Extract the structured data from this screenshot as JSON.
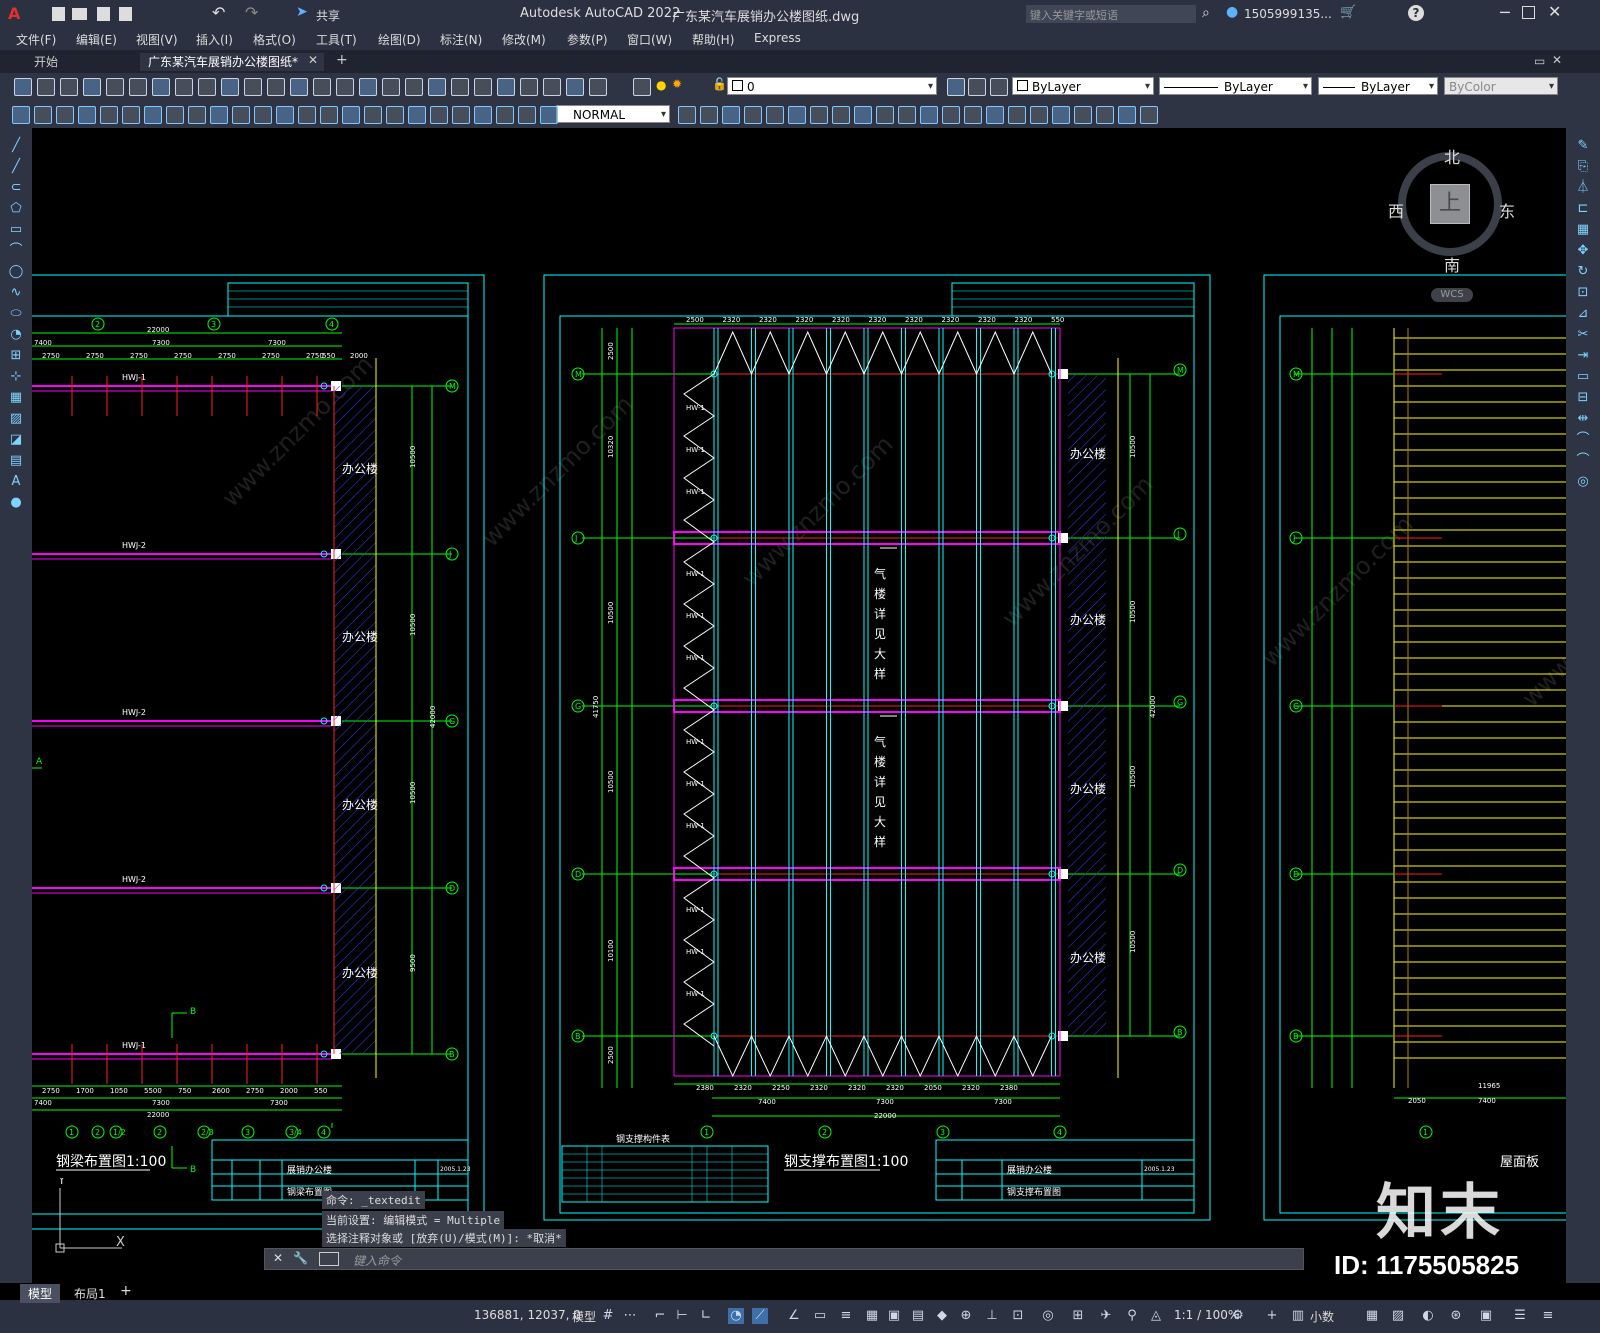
{
  "titlebar": {
    "app_title": "Autodesk AutoCAD 2022",
    "file_name": "广东某汽车展销办公楼图纸.dwg",
    "share_label": "共享",
    "search_placeholder": "键入关键字或短语",
    "user": "1505999135...",
    "app_letter": "A"
  },
  "menu": [
    "文件(F)",
    "编辑(E)",
    "视图(V)",
    "插入(I)",
    "格式(O)",
    "工具(T)",
    "绘图(D)",
    "标注(N)",
    "修改(M)",
    "参数(P)",
    "窗口(W)",
    "帮助(H)",
    "Express"
  ],
  "tabs": {
    "start": "开始",
    "drawing": "广东某汽车展销办公楼图纸*",
    "add": "+"
  },
  "toolbar": {
    "layer_value": "0",
    "color": "ByLayer",
    "linetype": "ByLayer",
    "lineweight": "ByLayer",
    "plotstyle": "ByColor",
    "textstyle": "NORMAL"
  },
  "viewcube": {
    "north": "北",
    "south": "南",
    "east": "东",
    "west": "西",
    "top": "上",
    "wcs": "WCS"
  },
  "drawing": {
    "sheet1": {
      "title": "钢梁布置图1:100",
      "beams": [
        "HWJ-1",
        "HWJ-2",
        "HWJ-2",
        "HWJ-2",
        "HWJ-1"
      ],
      "room_label": "办公楼",
      "axes": [
        "M",
        "J",
        "G",
        "D",
        "B"
      ],
      "top_axes": [
        "2",
        "3",
        "4"
      ],
      "project": "展销办公楼",
      "sheet_name": "钢梁布置图",
      "date": "2005.1.23",
      "marker_a": "A",
      "marker_b": "B",
      "top_dims": [
        "22000",
        "7400",
        "7300",
        "7300",
        "2750",
        "2750",
        "2750",
        "2750",
        "2750",
        "2750",
        "2750",
        "2000",
        "550"
      ],
      "right_dims": [
        "10500",
        "10500",
        "10500",
        "9500",
        "42000"
      ],
      "bot_dims": [
        "2750",
        "1700",
        "1050",
        "5500",
        "750",
        "2600",
        "2750",
        "2000",
        "550",
        "7400",
        "7300",
        "7300",
        "22000"
      ],
      "bot_axes": [
        "1",
        "2",
        "1/2",
        "2",
        "2/3",
        "3",
        "3/4",
        "4"
      ]
    },
    "sheet2": {
      "title": "钢支撑布置图1:100",
      "table_title": "钢支撑构件表",
      "room_label": "办公楼",
      "stair_note": "气楼详见大样",
      "axes": [
        "M",
        "J",
        "G",
        "D",
        "B"
      ],
      "bottom_axes": [
        "1",
        "2",
        "3",
        "4"
      ],
      "sheet_name": "钢支撑布置图",
      "project": "展销办公楼",
      "date": "2005.1.23",
      "hw_label": "HW-1",
      "top_dims": [
        "2500",
        "2320",
        "2320",
        "2320",
        "2320",
        "2320",
        "2320",
        "2320",
        "2320",
        "2320",
        "550"
      ],
      "bot_dims": [
        "2380",
        "2320",
        "2250",
        "2320",
        "2320",
        "2320",
        "2050",
        "2320",
        "2380"
      ],
      "bot_total": "22000",
      "bot_split": [
        "7400",
        "7300",
        "7300"
      ],
      "left_dims": [
        "2500",
        "10320",
        "10500",
        "10500",
        "10100",
        "2500"
      ],
      "left_total": "41750",
      "right_dims": [
        "10500",
        "10500",
        "10500",
        "10500",
        "42000"
      ]
    },
    "sheet3": {
      "title": "屋面板",
      "axes": [
        "M",
        "J",
        "G",
        "D",
        "B"
      ],
      "bottom_axis": "1",
      "dims": [
        "2050",
        "7400",
        "11965"
      ]
    }
  },
  "command": {
    "line1": "命令: _textedit",
    "line2": "当前设置: 编辑模式 = Multiple",
    "line3": "选择注释对象或 [放弃(U)/模式(M)]: *取消*",
    "placeholder": "键入命令"
  },
  "status": {
    "model_tab": "模型",
    "layout_tab": "布局1",
    "coords": "136881, 12037, 0",
    "model_label": "模型",
    "scale": "1:1 / 100%",
    "units": "小数"
  },
  "watermark": {
    "brand": "知末",
    "id": "ID: 1175505825"
  },
  "colors": {
    "accent": "#2ea4ff",
    "cyan": "#00ffff",
    "magenta": "#ff00ff",
    "green": "#00ff00",
    "red": "#ff2020",
    "yellow": "#ffff00",
    "blue": "#2a2aff"
  }
}
